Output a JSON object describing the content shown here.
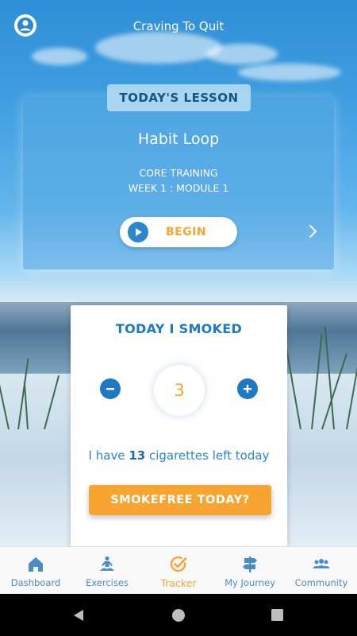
{
  "header": {
    "title": "Craving To Quit"
  },
  "lesson": {
    "tag": "TODAY'S LESSON",
    "name": "Habit Loop",
    "meta_line1": "CORE TRAINING",
    "meta_line2": "WEEK 1 : MODULE 1",
    "begin_label": "BEGIN"
  },
  "smoked": {
    "title": "TODAY I SMOKED",
    "count": "3",
    "left_prefix": "I have ",
    "left_count": "13",
    "left_suffix": " cigarettes left today",
    "button_label": "SMOKEFREE TODAY?"
  },
  "tabs": [
    {
      "label": "Dashboard",
      "icon": "home-icon"
    },
    {
      "label": "Exercises",
      "icon": "meditation-icon"
    },
    {
      "label": "Tracker",
      "icon": "check-circle-icon",
      "active": true
    },
    {
      "label": "My Journey",
      "icon": "signpost-icon"
    },
    {
      "label": "Community",
      "icon": "group-icon"
    }
  ],
  "colors": {
    "accent": "#f7a530",
    "primary": "#1d79c4",
    "tab_inactive": "#4a8dc5"
  }
}
